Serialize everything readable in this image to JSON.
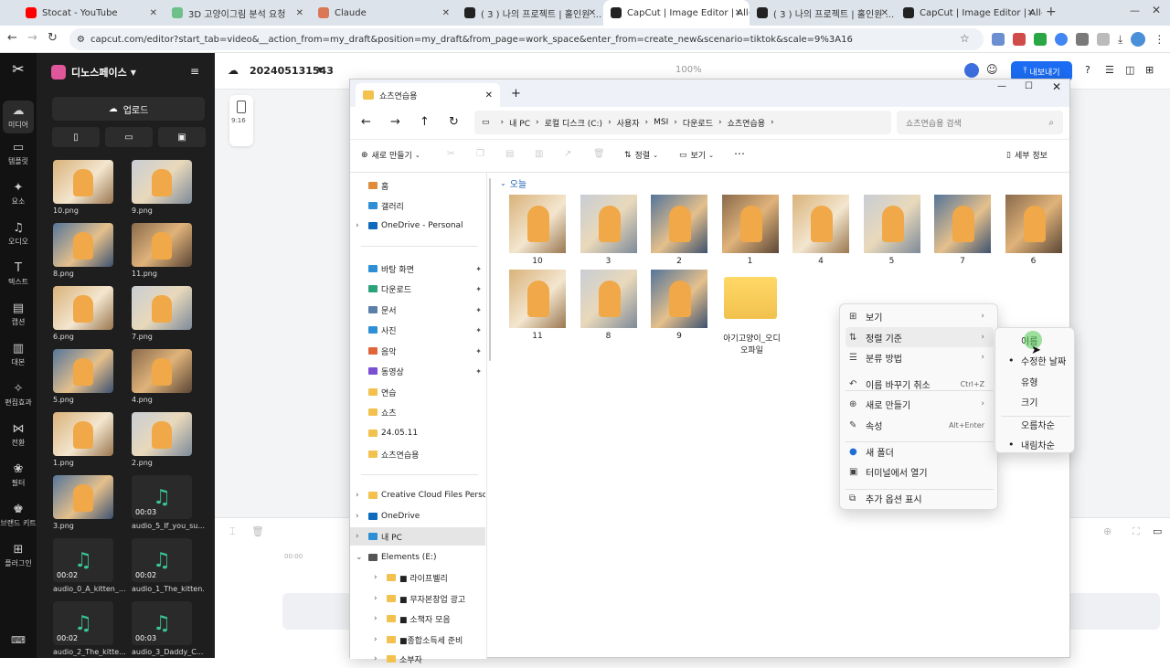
{
  "browser": {
    "tabs": [
      {
        "label": "Stocat - YouTube",
        "color": "#ff0000"
      },
      {
        "label": "3D 고양이그림 분석 요청",
        "color": "#6fbf8a"
      },
      {
        "label": "Claude",
        "color": "#d97757"
      },
      {
        "label": "( 3 ) 나의 프로젝트 | 홀인원 ...",
        "color": "#222222"
      },
      {
        "label": "CapCut | Image Editor | All-in...",
        "color": "#222222"
      },
      {
        "label": "( 3 ) 나의 프로젝트 | 홀인원 ...",
        "color": "#222222"
      },
      {
        "label": "CapCut | Image Editor | All-in...",
        "color": "#222222"
      }
    ],
    "url": "capcut.com/editor?start_tab=video&__action_from=my_draft&position=my_draft&from_page=work_space&enter_from=create_new&scenario=tiktok&scale=9%3A16"
  },
  "capcut": {
    "nav": [
      {
        "label": "미디어",
        "icon": "cloud-icon"
      },
      {
        "label": "템플릿",
        "icon": "template-icon"
      },
      {
        "label": "요소",
        "icon": "shapes-icon"
      },
      {
        "label": "오디오",
        "icon": "music-icon"
      },
      {
        "label": "텍스트",
        "icon": "text-icon"
      },
      {
        "label": "캡션",
        "icon": "caption-icon"
      },
      {
        "label": "대본",
        "icon": "script-icon"
      },
      {
        "label": "편집효과",
        "icon": "effects-icon"
      },
      {
        "label": "전환",
        "icon": "transition-icon"
      },
      {
        "label": "필터",
        "icon": "filter-icon"
      },
      {
        "label": "브랜드 키트",
        "icon": "brand-icon"
      },
      {
        "label": "플러그인",
        "icon": "plugin-icon"
      }
    ],
    "workspace": "디노스페이스",
    "upload": "업로드",
    "project_title": "202405131543",
    "zoom": "100%",
    "export": "내보내기",
    "aspect": "9:16",
    "timeline_time": "00:00",
    "media": [
      {
        "label": "10.png",
        "type": "image"
      },
      {
        "label": "9.png",
        "type": "image"
      },
      {
        "label": "8.png",
        "type": "image"
      },
      {
        "label": "11.png",
        "type": "image"
      },
      {
        "label": "6.png",
        "type": "image"
      },
      {
        "label": "7.png",
        "type": "image"
      },
      {
        "label": "5.png",
        "type": "image"
      },
      {
        "label": "4.png",
        "type": "image"
      },
      {
        "label": "1.png",
        "type": "image"
      },
      {
        "label": "2.png",
        "type": "image"
      },
      {
        "label": "3.png",
        "type": "image"
      },
      {
        "label": "audio_5_If_you_su...",
        "type": "audio",
        "duration": "00:03"
      },
      {
        "label": "audio_0_A_kitten_...",
        "type": "audio",
        "duration": "00:02"
      },
      {
        "label": "audio_1_The_kitten...",
        "type": "audio",
        "duration": "00:02"
      },
      {
        "label": "audio_2_The_kitte...",
        "type": "audio",
        "duration": "00:02"
      },
      {
        "label": "audio_3_Daddy_C...",
        "type": "audio",
        "duration": "00:03"
      }
    ]
  },
  "explorer": {
    "tab_title": "쇼츠연습용",
    "breadcrumb": [
      "내 PC",
      "로컬 디스크 (C:)",
      "사용자",
      "MSI",
      "다운로드",
      "쇼츠연습용"
    ],
    "search_placeholder": "쇼츠연습용 검색",
    "toolbar": {
      "new": "새로 만들기",
      "sort": "정렬",
      "view": "보기",
      "details": "세부 정보"
    },
    "sidebar": [
      {
        "label": "홈",
        "icon": "home-icon",
        "color": "#e08a3c"
      },
      {
        "label": "갤러리",
        "icon": "gallery-icon",
        "color": "#2f8fd6"
      },
      {
        "label": "OneDrive - Personal",
        "icon": "cloud-icon",
        "color": "#0f6cbd"
      },
      {
        "label": "바탕 화면",
        "icon": "desktop-icon",
        "color": "#2f8fd6"
      },
      {
        "label": "다운로드",
        "icon": "download-icon",
        "color": "#2aa37a"
      },
      {
        "label": "문서",
        "icon": "document-icon",
        "color": "#5b7fa8"
      },
      {
        "label": "사진",
        "icon": "photo-icon",
        "color": "#2f8fd6"
      },
      {
        "label": "음악",
        "icon": "music-icon",
        "color": "#e0663a"
      },
      {
        "label": "동영상",
        "icon": "video-icon",
        "color": "#7a4fd1"
      },
      {
        "label": "연습",
        "icon": "folder-icon",
        "color": "#f2c14e"
      },
      {
        "label": "쇼츠",
        "icon": "folder-icon",
        "color": "#f2c14e"
      },
      {
        "label": "24.05.11",
        "icon": "folder-icon",
        "color": "#f2c14e"
      },
      {
        "label": "쇼츠연습용",
        "icon": "folder-icon",
        "color": "#f2c14e"
      },
      {
        "label": "Creative Cloud Files Personal A",
        "icon": "folder-icon",
        "color": "#f2c14e"
      },
      {
        "label": "OneDrive",
        "icon": "cloud-icon",
        "color": "#0f6cbd"
      },
      {
        "label": "내 PC",
        "icon": "pc-icon",
        "color": "#2f8fd6"
      },
      {
        "label": "Elements (E:)",
        "icon": "drive-icon",
        "color": "#555555"
      },
      {
        "label": "■ 라이프벨리",
        "icon": "folder-icon",
        "color": "#f2c14e"
      },
      {
        "label": "■ 무자본창업 광고",
        "icon": "folder-icon",
        "color": "#f2c14e"
      },
      {
        "label": "■ 소책자 모음",
        "icon": "folder-icon",
        "color": "#f2c14e"
      },
      {
        "label": "■종합소득세 준비",
        "icon": "folder-icon",
        "color": "#f2c14e"
      },
      {
        "label": "소부자",
        "icon": "folder-icon",
        "color": "#f2c14e"
      }
    ],
    "group_label": "오늘",
    "files": [
      {
        "name": "10",
        "type": "image"
      },
      {
        "name": "3",
        "type": "image"
      },
      {
        "name": "2",
        "type": "image"
      },
      {
        "name": "1",
        "type": "image"
      },
      {
        "name": "4",
        "type": "image"
      },
      {
        "name": "5",
        "type": "image"
      },
      {
        "name": "7",
        "type": "image"
      },
      {
        "name": "6",
        "type": "image"
      },
      {
        "name": "11",
        "type": "image"
      },
      {
        "name": "8",
        "type": "image"
      },
      {
        "name": "9",
        "type": "image"
      },
      {
        "name": "아기고양이_오디오파일",
        "type": "folder"
      }
    ]
  },
  "context_menu": {
    "items": [
      {
        "label": "보기",
        "icon": "grid-icon",
        "submenu": true
      },
      {
        "label": "정렬 기준",
        "icon": "sort-icon",
        "submenu": true
      },
      {
        "label": "분류 방법",
        "icon": "group-icon",
        "submenu": true
      },
      {
        "label": "이름 바꾸기 취소",
        "icon": "undo-icon",
        "shortcut": "Ctrl+Z"
      },
      {
        "label": "새로 만들기",
        "icon": "plus-icon",
        "submenu": true
      },
      {
        "label": "속성",
        "icon": "wrench-icon",
        "shortcut": "Alt+Enter"
      },
      {
        "label": "새 폴더",
        "icon": "new-folder-icon"
      },
      {
        "label": "터미널에서 열기",
        "icon": "terminal-icon"
      },
      {
        "label": "추가 옵션 표시",
        "icon": "more-options-icon"
      }
    ]
  },
  "sort_submenu": {
    "items": [
      {
        "label": "이름",
        "checked": false,
        "highlighted": true
      },
      {
        "label": "수정한 날짜",
        "checked": true
      },
      {
        "label": "유형",
        "checked": false
      },
      {
        "label": "크기",
        "checked": false
      },
      {
        "label": "오름차순",
        "checked": false
      },
      {
        "label": "내림차순",
        "checked": true
      }
    ]
  }
}
